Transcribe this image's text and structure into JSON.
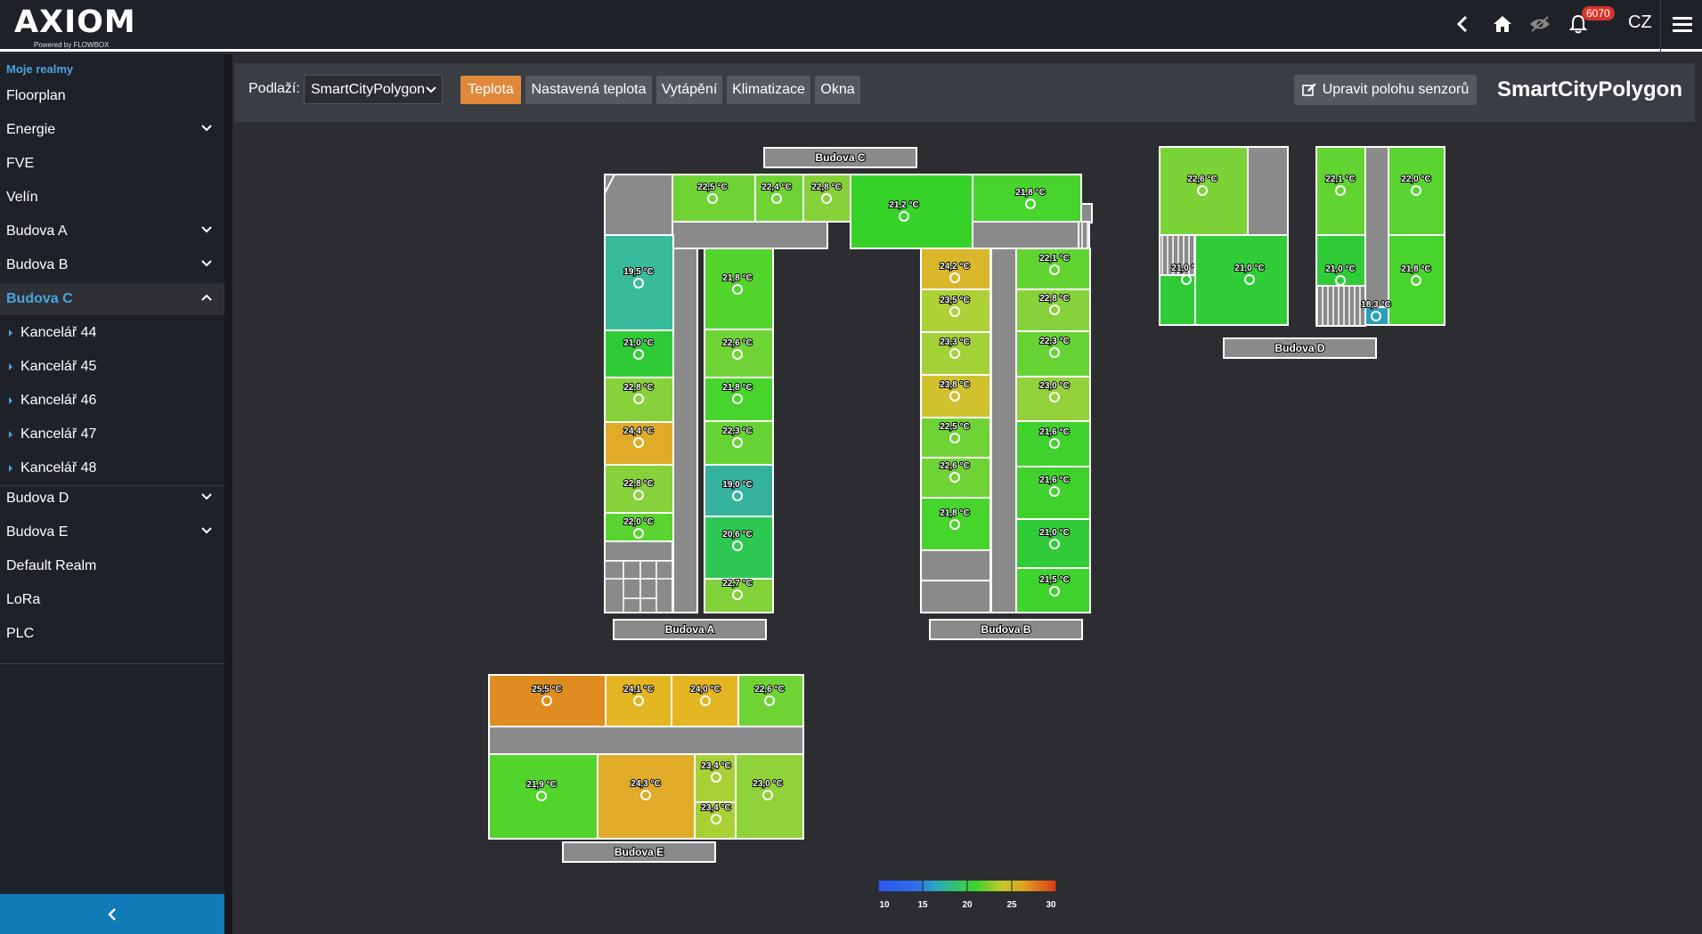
{
  "header": {
    "logo_text": "AXIOM",
    "logo_sub": "Powered by FLOWBOX",
    "notification_count": "6070",
    "language": "CZ",
    "icons": [
      "back-icon",
      "home-icon",
      "eye-slash-icon",
      "bell-icon",
      "hamburger-menu-icon"
    ]
  },
  "sidebar": {
    "title": "Moje realmy",
    "items": [
      {
        "label": "Floorplan",
        "expandable": false
      },
      {
        "label": "Energie",
        "expandable": true
      },
      {
        "label": "FVE",
        "expandable": false
      },
      {
        "label": "Velín",
        "expandable": false
      },
      {
        "label": "Budova A",
        "expandable": true
      },
      {
        "label": "Budova B",
        "expandable": true
      },
      {
        "label": "Budova C",
        "expandable": true,
        "active": true
      },
      {
        "label": "Budova D",
        "expandable": true
      },
      {
        "label": "Budova E",
        "expandable": true
      },
      {
        "label": "Default Realm",
        "expandable": false
      },
      {
        "label": "LoRa",
        "expandable": false
      },
      {
        "label": "PLC",
        "expandable": false
      }
    ],
    "subitems": [
      "Kancelář 44",
      "Kancelář 45",
      "Kancelář 46",
      "Kancelář 47",
      "Kancelář 48"
    ]
  },
  "toolbar": {
    "floor_label": "Podlaží:",
    "floor_value": "SmartCityPolygon",
    "buttons": [
      "Teplota",
      "Nastavená teplota",
      "Vytápění",
      "Klimatizace",
      "Okna"
    ],
    "active_button": "Teplota",
    "edit_label": "Upravit polohu senzorů",
    "title": "SmartCityPolygon"
  },
  "colors": {
    "accent_blue": "#4aa3df",
    "active_orange": "#e0883a",
    "badge_red": "#d9342b",
    "corridor_gray": "#8a8a8a"
  },
  "buildings": [
    {
      "label": "Budova C"
    },
    {
      "label": "Budova D"
    },
    {
      "label": "Budova A"
    },
    {
      "label": "Budova B"
    },
    {
      "label": "Budova E"
    }
  ],
  "rooms": [
    {
      "t": "22,5 °C",
      "c": "#6fd336"
    },
    {
      "t": "22,4 °C",
      "c": "#6fd336"
    },
    {
      "t": "22,8 °C",
      "c": "#86d23a"
    },
    {
      "t": "21,2 °C",
      "c": "#36d22a"
    },
    {
      "t": "21,8 °C",
      "c": "#47d42c"
    },
    {
      "t": "19,5 °C",
      "c": "#38bb9a"
    },
    {
      "t": "21,8 °C",
      "c": "#52d42c"
    },
    {
      "t": "21,0 °C",
      "c": "#30cc38"
    },
    {
      "t": "22,6 °C",
      "c": "#6fd336"
    },
    {
      "t": "22,8 °C",
      "c": "#86d23a"
    },
    {
      "t": "21,8 °C",
      "c": "#47d42c"
    },
    {
      "t": "24,4 °C",
      "c": "#e0ab28"
    },
    {
      "t": "22,3 °C",
      "c": "#66d334"
    },
    {
      "t": "22,8 °C",
      "c": "#86d23a"
    },
    {
      "t": "19,0 °C",
      "c": "#35b39e"
    },
    {
      "t": "22,0 °C",
      "c": "#5ad430"
    },
    {
      "t": "20,6 °C",
      "c": "#2ec955"
    },
    {
      "t": "22,7 °C",
      "c": "#80d238"
    },
    {
      "t": "24,2 °C",
      "c": "#d9b62a"
    },
    {
      "t": "22,1 °C",
      "c": "#62d432"
    },
    {
      "t": "23,5 °C",
      "c": "#aed136"
    },
    {
      "t": "22,8 °C",
      "c": "#86d23a"
    },
    {
      "t": "23,3 °C",
      "c": "#a3d138"
    },
    {
      "t": "22,3 °C",
      "c": "#66d334"
    },
    {
      "t": "23,8 °C",
      "c": "#cfc22e"
    },
    {
      "t": "23,0 °C",
      "c": "#92d13a"
    },
    {
      "t": "22,5 °C",
      "c": "#6fd336"
    },
    {
      "t": "21,6 °C",
      "c": "#3fd22c"
    },
    {
      "t": "22,6 °C",
      "c": "#6fd336"
    },
    {
      "t": "21,6 °C",
      "c": "#3fd22c"
    },
    {
      "t": "21,8 °C",
      "c": "#47d42c"
    },
    {
      "t": "21,0 °C",
      "c": "#30cc38"
    },
    {
      "t": "21,5 °C",
      "c": "#3dd22c"
    },
    {
      "t": "22,6 °C",
      "c": "#7bd337"
    },
    {
      "t": "22,1 °C",
      "c": "#62d432"
    },
    {
      "t": "22,0 °C",
      "c": "#5ad430"
    },
    {
      "t": "21,0 °C",
      "c": "#30cc38"
    },
    {
      "t": "21,0 °C",
      "c": "#30cc38"
    },
    {
      "t": "21,0 °C",
      "c": "#30cc38"
    },
    {
      "t": "21,8 °C",
      "c": "#47d42c"
    },
    {
      "t": "18,3 °C",
      "c": "#2a9fb8"
    },
    {
      "t": "25,5 °C",
      "c": "#de8c1f"
    },
    {
      "t": "24,1 °C",
      "c": "#e3b523"
    },
    {
      "t": "24,0 °C",
      "c": "#e3b523"
    },
    {
      "t": "22,6 °C",
      "c": "#6fd336"
    },
    {
      "t": "21,9 °C",
      "c": "#52d42c"
    },
    {
      "t": "24,3 °C",
      "c": "#e0ab28"
    },
    {
      "t": "23,4 °C",
      "c": "#a9d136"
    },
    {
      "t": "23,0 °C",
      "c": "#8fd23a"
    },
    {
      "t": "23,4 °C",
      "c": "#a9d136"
    }
  ],
  "legend": {
    "ticks": [
      "10",
      "15",
      "20",
      "25",
      "30"
    ]
  }
}
